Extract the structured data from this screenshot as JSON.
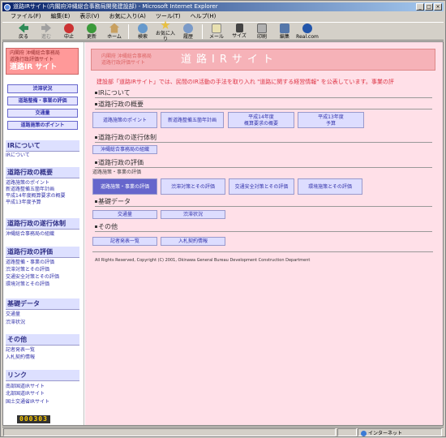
{
  "window": {
    "title": "道路IRサイト(内閣府沖縄総合事務局開発建設部) - Microsoft Internet Explorer",
    "controls": [
      "_",
      "□",
      "×"
    ]
  },
  "menu": [
    "ファイル(F)",
    "編集(E)",
    "表示(V)",
    "お気に入り(A)",
    "ツール(T)",
    "ヘルプ(H)"
  ],
  "toolbar": [
    {
      "label": "戻る",
      "icon": "back-icon",
      "enabled": true
    },
    {
      "label": "進む",
      "icon": "forward-icon",
      "enabled": false
    },
    {
      "label": "中止",
      "icon": "stop-icon",
      "enabled": true
    },
    {
      "label": "更新",
      "icon": "refresh-icon",
      "enabled": true
    },
    {
      "label": "ホーム",
      "icon": "home-icon",
      "enabled": true
    },
    {
      "label": "検索",
      "icon": "search-icon",
      "enabled": true
    },
    {
      "label": "お気に入り",
      "icon": "favorites-icon",
      "enabled": true
    },
    {
      "label": "履歴",
      "icon": "history-icon",
      "enabled": true
    },
    {
      "label": "メール",
      "icon": "mail-icon",
      "enabled": true
    },
    {
      "label": "サイズ",
      "icon": "font-size-icon",
      "enabled": true
    },
    {
      "label": "印刷",
      "icon": "print-icon",
      "enabled": true
    },
    {
      "label": "編集",
      "icon": "edit-icon",
      "enabled": true
    },
    {
      "label": "Real.com",
      "icon": "realcom-icon",
      "enabled": true
    }
  ],
  "sidebar": {
    "org": "内閣府 沖縄総合事務局",
    "org2": "道路行政評価サイト",
    "site": "道路IR サイト",
    "nav": [
      "渋滞状況",
      "道路整備・事業の評価",
      "交通量",
      "道路施策のポイント"
    ],
    "sections": [
      {
        "title": "IRについて",
        "links": [
          "IRについて"
        ]
      },
      {
        "title": "道路行政の概要",
        "links": [
          "道路施策のポイント",
          "新道路整備五箇年計画",
          "平成14年度概算要求の概要",
          "平成13年度予算"
        ]
      },
      {
        "title": "道路行政の遂行体制",
        "links": [
          "沖縄総合事務局の組織"
        ]
      },
      {
        "title": "道路行政の評価",
        "links": [
          "道路整備・事業の評価",
          "渋滞対策とその評価",
          "交通安全対策とその評価",
          "環境対策とその評価"
        ]
      },
      {
        "title": "基礎データ",
        "links": [
          "交通量",
          "渋滞状況"
        ]
      },
      {
        "title": "その他",
        "links": [
          "記者発表一覧",
          "入札契約情報"
        ]
      },
      {
        "title": "リンク",
        "links": [
          "南部国道IRサイト",
          "北部国道IRサイト",
          "国土交通省IRサイト"
        ]
      }
    ],
    "counter": "000303"
  },
  "main": {
    "banner_sub1": "内閣府 沖縄総合事務局",
    "banner_sub2": "道路行政評価サイト",
    "banner_title": "道路IRサイト",
    "intro": "建設部「道路IRサイト」では、民間のIR活動の手法を取り入れ \"道路に関する経営情報\" を公表しています。事業の評",
    "h_ir": "IRについて",
    "h_overview": "道路行政の概要",
    "overview_btns": [
      "道路施策のポイント",
      "新道路整備五箇年計画",
      "平成14年度|概算要求の概要",
      "平成13年度|予算"
    ],
    "h_system": "道路行政の遂行体制",
    "system_btns": [
      "沖縄総合事務局の組織"
    ],
    "h_eval": "道路行政の評価",
    "eval_caption": "道路施策・事業の評価",
    "eval_btns": [
      "道路施策・事業の評価",
      "渋滞対策とその評価",
      "交通安全対策とその評価",
      "環境施策とその評価"
    ],
    "h_data": "基礎データ",
    "data_btns": [
      "交通量",
      "渋滞状況"
    ],
    "h_other": "その他",
    "other_btns": [
      "記者発表一覧",
      "入札契約情報"
    ],
    "copyright": "All Rights Reserved, Copyright (C) 2001, Okinawa General Bureau Development Construction Department"
  },
  "status": {
    "zone": "インターネット"
  }
}
